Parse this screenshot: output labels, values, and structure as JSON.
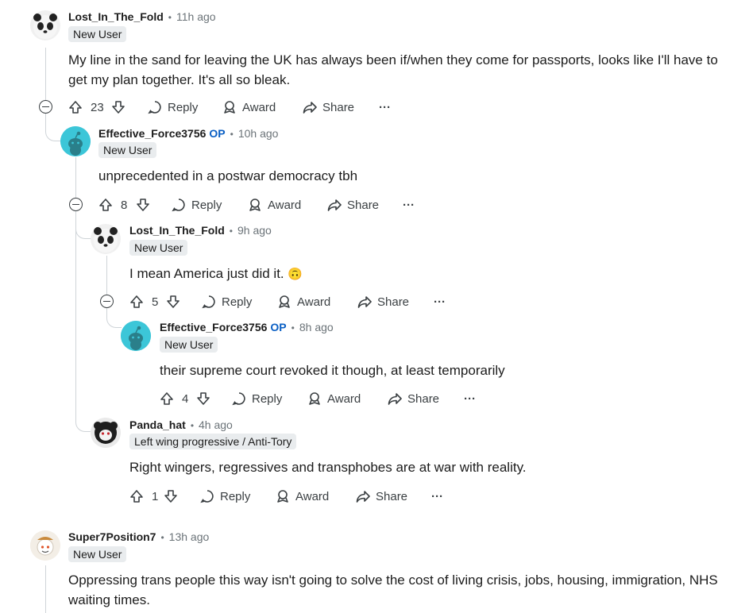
{
  "comments": [
    {
      "user": "Lost_In_The_Fold",
      "op": "",
      "time": "11h ago",
      "flair": "New User",
      "lines": [
        "My line in the sand for leaving the UK has always been if/when they come for passports, looks like I'll have to",
        "get my plan together. It's all so bleak."
      ],
      "votes": "23"
    },
    {
      "user": "Effective_Force3756",
      "op": "OP",
      "time": "10h ago",
      "flair": "New User",
      "lines": [
        "unprecedented in a postwar democracy tbh"
      ],
      "votes": "8"
    },
    {
      "user": "Lost_In_The_Fold",
      "op": "",
      "time": "9h ago",
      "flair": "New User",
      "lines": [
        "I mean America just did it."
      ],
      "emoji": "🙃",
      "votes": "5"
    },
    {
      "user": "Effective_Force3756",
      "op": "OP",
      "time": "8h ago",
      "flair": "New User",
      "lines": [
        "their supreme court revoked it though, at least temporarily"
      ],
      "votes": "4"
    },
    {
      "user": "Panda_hat",
      "op": "",
      "time": "4h ago",
      "flair": "Left wing progressive / Anti-Tory",
      "lines": [
        "Right wingers, regressives and transphobes are at war with reality."
      ],
      "votes": "1"
    },
    {
      "user": "Super7Position7",
      "op": "",
      "time": "13h ago",
      "flair": "New User",
      "lines": [
        "Oppressing trans people this way isn't going to solve the cost of living crisis, jobs, housing, immigration, NHS",
        "waiting times."
      ]
    }
  ],
  "actions": {
    "reply": "Reply",
    "award": "Award",
    "share": "Share",
    "more": "···"
  },
  "icons": {
    "upvote": "upvote-icon",
    "downvote": "downvote-icon",
    "reply": "reply-icon",
    "award": "award-icon",
    "share": "share-icon",
    "more": "more-icon",
    "collapse": "collapse-icon"
  }
}
